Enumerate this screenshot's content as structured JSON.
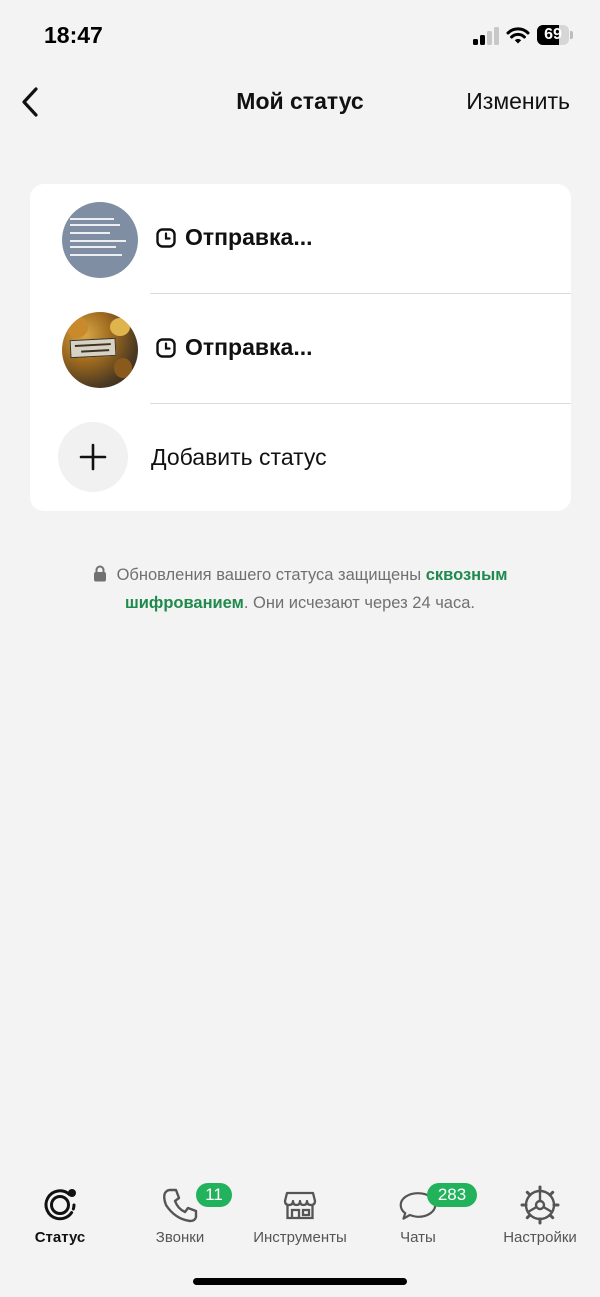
{
  "status_bar": {
    "time": "18:47",
    "battery_percent": "69",
    "battery_level": 0.69
  },
  "header": {
    "title": "Мой статус",
    "edit_label": "Изменить"
  },
  "statuses": [
    {
      "label": "Отправка..."
    },
    {
      "label": "Отправка..."
    }
  ],
  "add_status_label": "Добавить статус",
  "info": {
    "text_before": "Обновления вашего статуса защищены",
    "link": "сквозным шифрованием",
    "text_after": ". Они исчезают через 24 часа."
  },
  "tabs": [
    {
      "label": "Статус",
      "active": true,
      "icon": "status-icon"
    },
    {
      "label": "Звонки",
      "badge": "11",
      "icon": "phone-icon"
    },
    {
      "label": "Инструменты",
      "icon": "store-icon"
    },
    {
      "label": "Чаты",
      "badge": "283",
      "icon": "chat-icon"
    },
    {
      "label": "Настройки",
      "icon": "settings-icon"
    }
  ],
  "colors": {
    "accent": "#21b25b",
    "link": "#1f8a4c",
    "background": "#f3f3f3"
  }
}
